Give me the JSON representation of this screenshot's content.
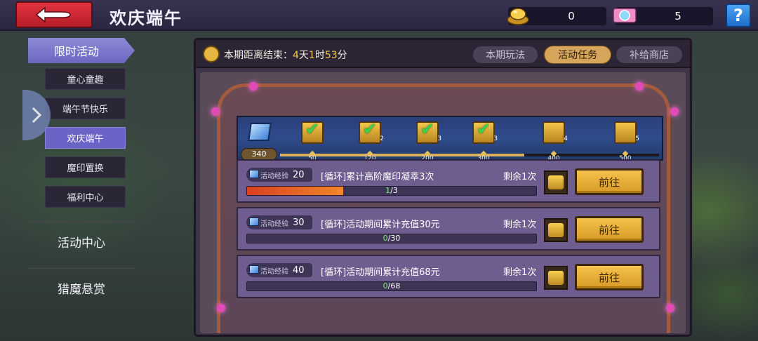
{
  "header": {
    "title": "欢庆端午",
    "gold_amount": "0",
    "gem_amount": "5",
    "help_label": "?"
  },
  "sidebar": {
    "main_label": "限时活动",
    "sub_items": [
      {
        "label": "童心童趣"
      },
      {
        "label": "端午节快乐"
      },
      {
        "label": "欢庆端午"
      },
      {
        "label": "魔印置换"
      },
      {
        "label": "福利中心"
      }
    ],
    "big_items": [
      {
        "label": "活动中心"
      },
      {
        "label": "猎魔悬赏"
      }
    ]
  },
  "panel": {
    "timer_prefix": "本期距离结束：",
    "days": "4",
    "days_unit": "天",
    "hours": "1",
    "hours_unit": "时",
    "minutes": "53",
    "minutes_unit": "分",
    "tabs": [
      {
        "label": "本期玩法",
        "active": false
      },
      {
        "label": "活动任务",
        "active": true
      },
      {
        "label": "补给商店",
        "active": false
      }
    ]
  },
  "progress": {
    "current_exp": "340",
    "current_value": 340,
    "max_value": 500,
    "milestones": [
      {
        "value": "50",
        "claimed": true,
        "count": ""
      },
      {
        "value": "120",
        "claimed": true,
        "count": "2"
      },
      {
        "value": "200",
        "claimed": true,
        "count": "3"
      },
      {
        "value": "300",
        "claimed": true,
        "count": "3"
      },
      {
        "value": "400",
        "claimed": false,
        "count": "4"
      },
      {
        "value": "500",
        "claimed": false,
        "count": "5"
      }
    ]
  },
  "tasks": [
    {
      "exp_label": "活动经验",
      "exp_amount": "20",
      "title": "[循环]累计高阶魔印凝萃3次",
      "remaining": "剩余1次",
      "progress_current": "1",
      "progress_total": "/3",
      "progress_fraction": 0.333,
      "button_label": "前往"
    },
    {
      "exp_label": "活动经验",
      "exp_amount": "30",
      "title": "[循环]活动期间累计充值30元",
      "remaining": "剩余1次",
      "progress_current": "0",
      "progress_total": "/30",
      "progress_fraction": 0,
      "button_label": "前往"
    },
    {
      "exp_label": "活动经验",
      "exp_amount": "40",
      "title": "[循环]活动期间累计充值68元",
      "remaining": "剩余1次",
      "progress_current": "0",
      "progress_total": "/68",
      "progress_fraction": 0,
      "button_label": "前往"
    }
  ]
}
